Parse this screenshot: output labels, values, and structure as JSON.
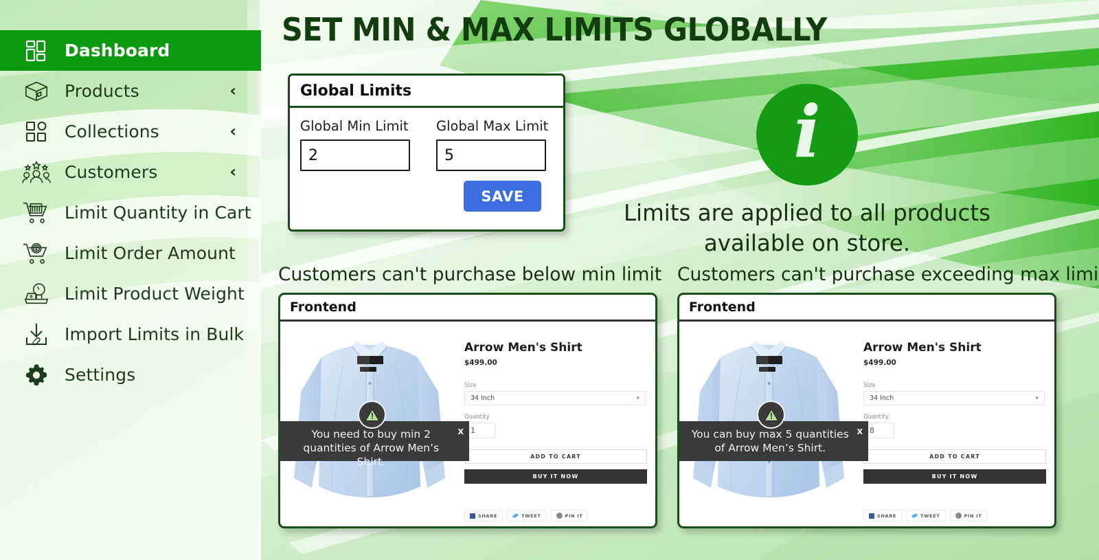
{
  "header": {
    "title": "SET MIN & MAX LIMITS GLOBALLY"
  },
  "sidebar": {
    "items": [
      {
        "label": "Dashboard",
        "icon": "dashboard-icon",
        "chevron": "",
        "active": true
      },
      {
        "label": "Products",
        "icon": "box-icon",
        "chevron": "‹",
        "active": false
      },
      {
        "label": "Collections",
        "icon": "grid-shapes-icon",
        "chevron": "‹",
        "active": false
      },
      {
        "label": "Customers",
        "icon": "customers-stars-icon",
        "chevron": "‹",
        "active": false
      },
      {
        "label": "Limit Quantity in Cart",
        "icon": "cart-icon",
        "chevron": "",
        "active": false
      },
      {
        "label": "Limit Order Amount",
        "icon": "cart-dollar-icon",
        "chevron": "",
        "active": false
      },
      {
        "label": "Limit Product Weight",
        "icon": "weight-scale-icon",
        "chevron": "",
        "active": false
      },
      {
        "label": "Import Limits in Bulk",
        "icon": "import-download-icon",
        "chevron": "",
        "active": false
      },
      {
        "label": "Settings",
        "icon": "gear-icon",
        "chevron": "",
        "active": false
      }
    ]
  },
  "global_limits": {
    "card_title": "Global Limits",
    "min_label": "Global Min Limit",
    "min_value": "2",
    "max_label": "Global Max Limit",
    "max_value": "5",
    "save_label": "SAVE",
    "save_color": "#3b6fe0",
    "border_color": "#174d17"
  },
  "info": {
    "icon": "info-circle-icon",
    "glyph": "i",
    "text": "Limits are applied to all products available on store."
  },
  "panels": [
    {
      "caption": "Customers can't purchase below min limit",
      "window_title": "Frontend",
      "product": {
        "name": "Arrow Men's Shirt",
        "price": "$499.00",
        "size_label": "Size",
        "size_value": "34 Inch",
        "qty_label": "Quantity",
        "qty_value": "1",
        "add_to_cart": "ADD TO CART",
        "buy_now": "BUY IT NOW",
        "share": [
          {
            "label": "SHARE",
            "icon": "facebook-icon"
          },
          {
            "label": "TWEET",
            "icon": "twitter-icon"
          },
          {
            "label": "PIN IT",
            "icon": "pinterest-icon"
          }
        ]
      },
      "tooltip": {
        "icon": "warning-triangle-icon",
        "message": "You need to buy min 2 quantities of Arrow Men’s Shirt.",
        "close": "X"
      }
    },
    {
      "caption": "Customers can't purchase exceeding max limit",
      "window_title": "Frontend",
      "product": {
        "name": "Arrow Men's Shirt",
        "price": "$499.00",
        "size_label": "Size",
        "size_value": "34 Inch",
        "qty_label": "Quantity",
        "qty_value": "8",
        "add_to_cart": "ADD TO CART",
        "buy_now": "BUY IT NOW",
        "share": [
          {
            "label": "SHARE",
            "icon": "facebook-icon"
          },
          {
            "label": "TWEET",
            "icon": "twitter-icon"
          },
          {
            "label": "PIN IT",
            "icon": "pinterest-icon"
          }
        ]
      },
      "tooltip": {
        "icon": "warning-triangle-icon",
        "message": "You can buy max 5 quantities of Arrow Men’s Shirt.",
        "close": "X"
      }
    }
  ],
  "colors": {
    "brand_green": "#0a9a0f",
    "dark_green": "#174d17",
    "accent_blue": "#3b6fe0",
    "tooltip_bg": "#3a3a3a"
  }
}
